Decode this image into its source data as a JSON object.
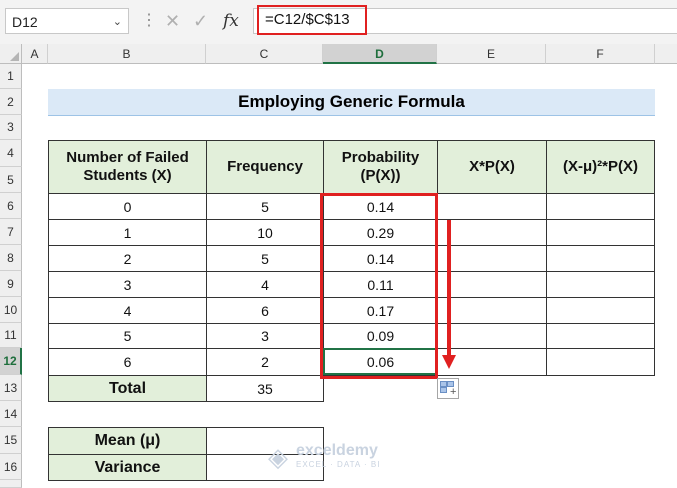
{
  "formula_bar": {
    "name_box": "D12",
    "formula": "=C12/$C$13",
    "dots": "⋮",
    "cancel_icon": "✕",
    "enter_icon": "✓",
    "fx_label": "fx"
  },
  "columns": [
    "A",
    "B",
    "C",
    "D",
    "E",
    "F"
  ],
  "rows": [
    "1",
    "2",
    "3",
    "4",
    "5",
    "6",
    "7",
    "8",
    "9",
    "10",
    "11",
    "12",
    "13",
    "14",
    "15",
    "16"
  ],
  "selected_cell": "D12",
  "title": "Employing Generic Formula",
  "table": {
    "headers": [
      "Number of Failed Students (X)",
      "Frequency",
      "Probability (P(X))",
      "X*P(X)",
      "(X-μ)²*P(X)"
    ],
    "data": [
      [
        "0",
        "5",
        "0.14",
        "",
        ""
      ],
      [
        "1",
        "10",
        "0.29",
        "",
        ""
      ],
      [
        "2",
        "5",
        "0.14",
        "",
        ""
      ],
      [
        "3",
        "4",
        "0.11",
        "",
        ""
      ],
      [
        "4",
        "6",
        "0.17",
        "",
        ""
      ],
      [
        "5",
        "3",
        "0.09",
        "",
        ""
      ],
      [
        "6",
        "2",
        "0.06",
        "",
        ""
      ]
    ],
    "total_label": "Total",
    "total_value": "35"
  },
  "summary": {
    "mean_label": "Mean (μ)",
    "mean_value": "",
    "variance_label": "Variance",
    "variance_value": ""
  },
  "watermark": {
    "name": "exceldemy",
    "tagline": "EXCEL · DATA · BI"
  },
  "colors": {
    "header_fill": "#e2efda",
    "title_fill": "#dbe9f7",
    "highlight": "#e02020",
    "selection": "#217346"
  }
}
